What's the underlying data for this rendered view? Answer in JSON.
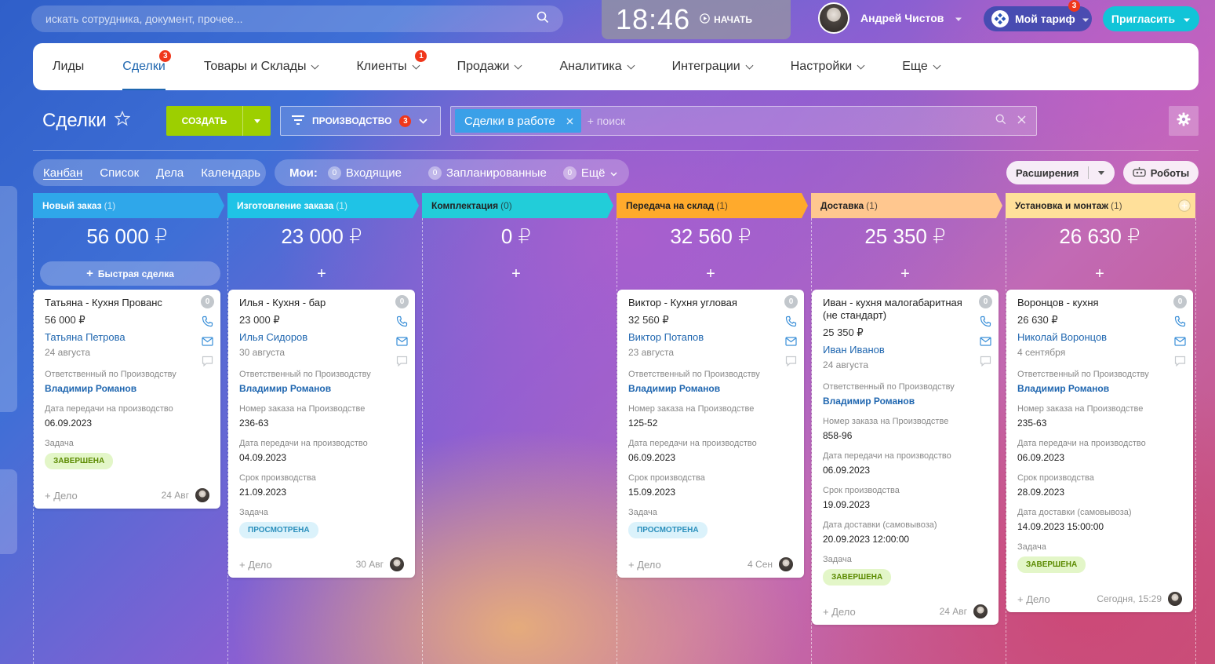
{
  "search": {
    "placeholder": "искать сотрудника, документ, прочее..."
  },
  "timer": {
    "time": "18:46",
    "start_label": "НАЧАТЬ"
  },
  "user": {
    "name": "Андрей Чистов"
  },
  "tariff": {
    "label": "Мой тариф",
    "badge": "3"
  },
  "invite": {
    "label": "Пригласить"
  },
  "menu": [
    {
      "label": "Лиды"
    },
    {
      "label": "Сделки",
      "badge": "3"
    },
    {
      "label": "Товары и Склады"
    },
    {
      "label": "Клиенты",
      "badge": "1"
    },
    {
      "label": "Продажи"
    },
    {
      "label": "Аналитика"
    },
    {
      "label": "Интеграции"
    },
    {
      "label": "Настройки"
    },
    {
      "label": "Еще"
    }
  ],
  "page": {
    "title": "Сделки"
  },
  "create": {
    "label": "СОЗДАТЬ"
  },
  "pipeline": {
    "label": "ПРОИЗВОДСТВО",
    "badge": "3"
  },
  "filter": {
    "chip": "Сделки в работе",
    "placeholder": "+ поиск"
  },
  "views": [
    "Канбан",
    "Список",
    "Дела",
    "Календарь"
  ],
  "counters": {
    "label": "Мои:",
    "items": [
      {
        "count": "0",
        "label": "Входящие"
      },
      {
        "count": "0",
        "label": "Запланированные"
      },
      {
        "count": "0",
        "label": "Ещё"
      }
    ]
  },
  "extensions": {
    "label": "Расширения"
  },
  "robots": {
    "label": "Роботы"
  },
  "colors": {
    "new": "#2fa7ea",
    "production": "#1fc3e6",
    "complect": "#22cdd9",
    "warehouse": "#ffaa2c",
    "delivery": "#ffc78f",
    "install": "#ffe09a"
  },
  "quick_deal": "Быстрая сделка",
  "columns": [
    {
      "name": "Новый заказ",
      "count": "(1)",
      "sum": "56 000 ₽"
    },
    {
      "name": "Изготовление заказа",
      "count": "(1)",
      "sum": "23 000 ₽"
    },
    {
      "name": "Комплектация",
      "count": "(0)",
      "sum": "0 ₽"
    },
    {
      "name": "Передача на склад",
      "count": "(1)",
      "sum": "32 560 ₽"
    },
    {
      "name": "Доставка",
      "count": "(1)",
      "sum": "25 350 ₽"
    },
    {
      "name": "Установка и монтаж",
      "count": "(1)",
      "sum": "26 630 ₽"
    }
  ],
  "cards": [
    {
      "title": "Татьяна - Кухня Прованс",
      "sum": "56 000 ₽",
      "client": "Татьяна Петрова",
      "date": "24 августа",
      "counter": "0",
      "fields": [
        {
          "label": "Ответственный по Производству",
          "value": "Владимир Романов",
          "blue": true
        },
        {
          "label": "Дата передачи на производство",
          "value": "06.09.2023"
        }
      ],
      "task_label": "Задача",
      "task": "ЗАВЕРШЕНА",
      "add": "+ Дело",
      "foot_date": "24 Авг"
    },
    {
      "title": "Илья - Кухня - бар",
      "sum": "23 000 ₽",
      "client": "Илья Сидоров",
      "date": "30 августа",
      "counter": "0",
      "fields": [
        {
          "label": "Ответственный по Производству",
          "value": "Владимир Романов",
          "blue": true
        },
        {
          "label": "Номер заказа на Производстве",
          "value": "236-63"
        },
        {
          "label": "Дата передачи на производство",
          "value": "04.09.2023"
        },
        {
          "label": "Срок производства",
          "value": "21.09.2023"
        }
      ],
      "task_label": "Задача",
      "task": "ПРОСМОТРЕНА",
      "add": "+ Дело",
      "foot_date": "30 Авг"
    },
    {
      "title": "Виктор - Кухня угловая",
      "sum": "32 560 ₽",
      "client": "Виктор Потапов",
      "date": "23 августа",
      "counter": "0",
      "fields": [
        {
          "label": "Ответственный по Производству",
          "value": "Владимир Романов",
          "blue": true
        },
        {
          "label": "Номер заказа на Производстве",
          "value": "125-52"
        },
        {
          "label": "Дата передачи на производство",
          "value": "06.09.2023"
        },
        {
          "label": "Срок производства",
          "value": "15.09.2023"
        }
      ],
      "task_label": "Задача",
      "task": "ПРОСМОТРЕНА",
      "add": "+ Дело",
      "foot_date": "4 Сен"
    },
    {
      "title": "Иван - кухня малогабаритная (не стандарт)",
      "sum": "25 350 ₽",
      "client": "Иван Иванов",
      "date": "24 августа",
      "counter": "0",
      "fields": [
        {
          "label": "Ответственный по Производству",
          "value": "Владимир Романов",
          "blue": true
        },
        {
          "label": "Номер заказа на Производстве",
          "value": "858-96"
        },
        {
          "label": "Дата передачи на производство",
          "value": "06.09.2023"
        },
        {
          "label": "Срок производства",
          "value": "19.09.2023"
        },
        {
          "label": "Дата доставки (самовывоза)",
          "value": "20.09.2023 12:00:00"
        }
      ],
      "task_label": "Задача",
      "task": "ЗАВЕРШЕНА",
      "add": "+ Дело",
      "foot_date": "24 Авг"
    },
    {
      "title": "Воронцов - кухня",
      "sum": "26 630 ₽",
      "client": "Николай Воронцов",
      "date": "4 сентября",
      "counter": "0",
      "fields": [
        {
          "label": "Ответственный по Производству",
          "value": "Владимир Романов",
          "blue": true
        },
        {
          "label": "Номер заказа на Производстве",
          "value": "235-63"
        },
        {
          "label": "Дата передачи на производство",
          "value": "06.09.2023"
        },
        {
          "label": "Срок производства",
          "value": "28.09.2023"
        },
        {
          "label": "Дата доставки (самовывоза)",
          "value": "14.09.2023 15:00:00"
        }
      ],
      "task_label": "Задача",
      "task": "ЗАВЕРШЕНА",
      "add": "+ Дело",
      "foot_date": "Сегодня, 15:29"
    }
  ]
}
